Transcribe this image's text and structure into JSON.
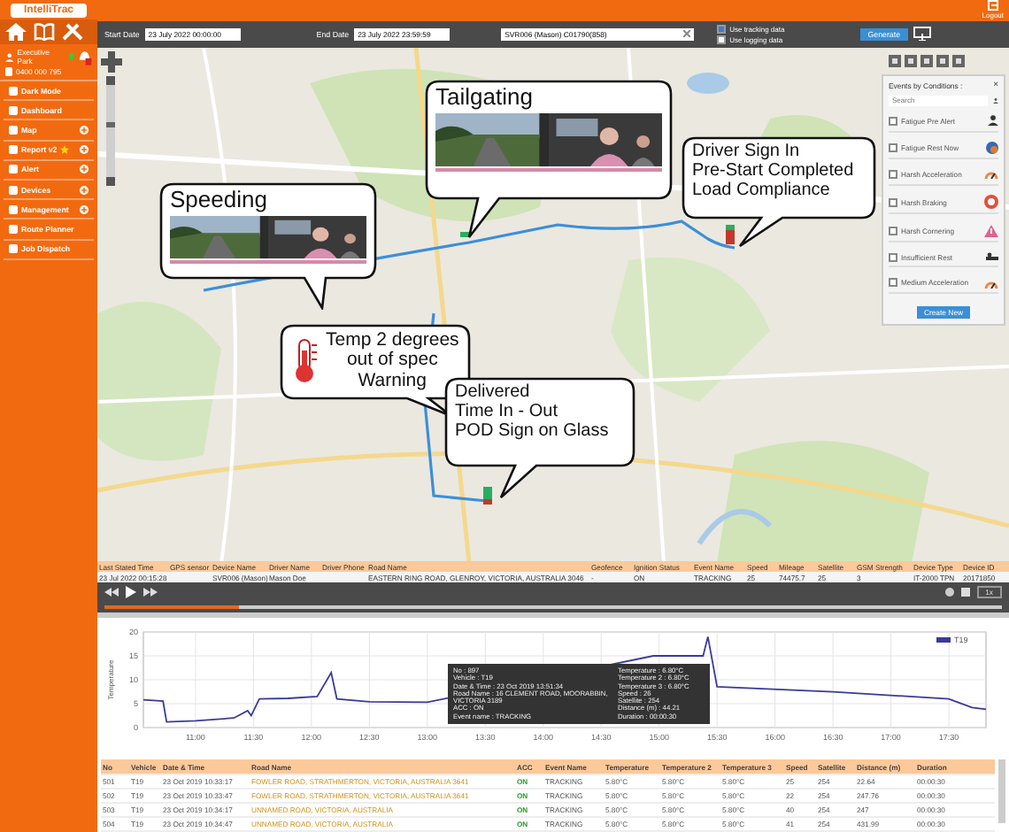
{
  "header": {
    "logout": "Logout"
  },
  "sidebar": {
    "logo": "IntelliTrac",
    "user": {
      "name": "Executive Park",
      "phone": "0400 000 795",
      "alert_badge": true
    },
    "menu": [
      {
        "label": "Dark Mode",
        "expandable": false,
        "starred": false
      },
      {
        "label": "Dashboard",
        "expandable": false,
        "starred": false
      },
      {
        "label": "Map",
        "expandable": true,
        "starred": false
      },
      {
        "label": "Report v2",
        "expandable": true,
        "starred": true
      },
      {
        "label": "Alert",
        "expandable": true,
        "starred": false
      },
      {
        "label": "Devices",
        "expandable": true,
        "starred": false
      },
      {
        "label": "Management",
        "expandable": true,
        "starred": false
      },
      {
        "label": "Route Planner",
        "expandable": false,
        "starred": false
      },
      {
        "label": "Job Dispatch",
        "expandable": false,
        "starred": false
      }
    ]
  },
  "toolbar": {
    "start_date": {
      "label": "Start Date",
      "value": "23 July 2022 00:00:00"
    },
    "end_date": {
      "label": "End Date",
      "value": "23 July 2022 23:59:59"
    },
    "vehicle": {
      "value": "SVR006 (Mason) C01790(858)"
    },
    "options": [
      {
        "label": "Use tracking data",
        "checked": true
      },
      {
        "label": "Use logging data",
        "checked": false
      }
    ],
    "generate": "Generate"
  },
  "map": {
    "callouts": [
      {
        "kind": "video",
        "lines": [
          "Speeding"
        ]
      },
      {
        "kind": "video",
        "lines": [
          "Tailgating"
        ]
      },
      {
        "kind": "text",
        "lines": [
          "Driver Sign In",
          "Pre-Start Completed",
          "Load Compliance"
        ]
      },
      {
        "kind": "temperature",
        "lines": [
          "Temp 2 degrees",
          "out of spec",
          "Warning"
        ]
      },
      {
        "kind": "text",
        "lines": [
          "Delivered",
          "Time In - Out",
          "POD Sign on Glass"
        ]
      }
    ],
    "events_panel": {
      "title": "Events by Conditions :",
      "close": "×",
      "search_placeholder": "Search",
      "items": [
        {
          "label": "Fatigue Pre Alert",
          "checked": false
        },
        {
          "label": "Fatigue Rest Now",
          "checked": false
        },
        {
          "label": "Harsh Acceleration",
          "checked": false
        },
        {
          "label": "Harsh Braking",
          "checked": false
        },
        {
          "label": "Harsh Cornering",
          "checked": false
        },
        {
          "label": "Insufficient Rest",
          "checked": false
        },
        {
          "label": "Medium Acceleration",
          "checked": false
        }
      ],
      "button": "Create New"
    }
  },
  "live_table": {
    "columns": [
      "Last Stated Time",
      "GPS sensor",
      "Device Name",
      "Driver Name",
      "Driver Phone",
      "Road Name",
      "Geofence",
      "Ignition Status",
      "Event Name",
      "Speed",
      "Mileage",
      "Satellite",
      "GSM Strength",
      "Device Type",
      "Device ID"
    ],
    "rows": [
      [
        "23 Jul 2022 00:15:28",
        "",
        "SVR006 (Mason)",
        "Mason Doe",
        "",
        "EASTERN RING ROAD, GLENROY, VICTORIA, AUSTRALIA 3046",
        "-",
        "ON",
        "TRACKING",
        "25",
        "74475.7",
        "25",
        "3",
        "IT-2000 TPN",
        "20171850"
      ]
    ]
  },
  "map_zoom": {
    "level": 0.55
  },
  "player": {
    "level": 0.15,
    "speed": "1x"
  },
  "chart": {
    "tooltip": [
      "No : 897",
      "Vehicle : T19",
      "Date & Time : 23 Oct 2019 13:51:34",
      "Road Name : 16 CLEMENT ROAD, MOORABBIN, VICTORIA 3189",
      "ACC : ON",
      "Event name : TRACKING",
      "Temperature : 6.80°C",
      "Temperature 2 : 6.80°C",
      "Temperature 3 : 6.80°C",
      "Speed : 26",
      "Satellite : 254",
      "Distance (m) : 44.21",
      "Duration : 00:00:30"
    ],
    "chart_data": {
      "type": "line",
      "grid": true,
      "ylabel": "Temperature",
      "x": [
        10.55,
        10.72,
        10.75,
        11.0,
        11.33,
        11.45,
        11.48,
        11.55,
        11.8,
        12.05,
        12.17,
        12.22,
        12.5,
        13.0,
        14.95,
        15.38,
        15.42,
        15.5,
        16.5,
        17.5,
        17.55,
        17.7,
        17.82
      ],
      "series": [
        {
          "name": "T19",
          "color": "#3a3a9a",
          "values": [
            5.8,
            5.5,
            1.2,
            1.4,
            2.0,
            3.5,
            2.5,
            6.0,
            6.1,
            6.5,
            11.5,
            6.0,
            5.4,
            5.3,
            15.0,
            15.0,
            19.0,
            8.5,
            7.5,
            6.0,
            5.5,
            4.2,
            3.8
          ]
        }
      ],
      "xlim": [
        10.55,
        17.82
      ],
      "ylim": [
        0,
        20
      ],
      "yticks": [
        0,
        5,
        10,
        15,
        20
      ],
      "xticks": [
        {
          "value": 11,
          "label": "11:00"
        },
        {
          "value": 11.5,
          "label": "11:30"
        },
        {
          "value": 12,
          "label": "12:00"
        },
        {
          "value": 12.5,
          "label": "12:30"
        },
        {
          "value": 13,
          "label": "13:00"
        },
        {
          "value": 13.5,
          "label": "13:30"
        },
        {
          "value": 14,
          "label": "14:00"
        },
        {
          "value": 14.5,
          "label": "14:30"
        },
        {
          "value": 15,
          "label": "15:00"
        },
        {
          "value": 15.5,
          "label": "15:30"
        },
        {
          "value": 16,
          "label": "16:00"
        },
        {
          "value": 16.5,
          "label": "16:30"
        },
        {
          "value": 17,
          "label": "17:00"
        },
        {
          "value": 17.5,
          "label": "17:30"
        }
      ]
    }
  },
  "history_table": {
    "columns": [
      "No",
      "Vehicle",
      "Date & Time",
      "Road Name",
      "ACC",
      "Event Name",
      "Temperature",
      "Temperature 2",
      "Temperature 3",
      "Speed",
      "Satellite",
      "Distance (m)",
      "Duration"
    ],
    "rows": [
      [
        "501",
        "T19",
        "23 Oct 2019 10:33:17",
        "FOWLER ROAD, STRATHMERTON, VICTORIA, AUSTRALIA 3641",
        "ON",
        "TRACKING",
        "5.80°C",
        "5.80°C",
        "5.80°C",
        "25",
        "254",
        "22.64",
        "00:00:30"
      ],
      [
        "502",
        "T19",
        "23 Oct 2019 10:33:47",
        "FOWLER ROAD, STRATHMERTON, VICTORIA, AUSTRALIA 3641",
        "ON",
        "TRACKING",
        "5.80°C",
        "5.80°C",
        "5.80°C",
        "22",
        "254",
        "247.76",
        "00:00:30"
      ],
      [
        "503",
        "T19",
        "23 Oct 2019 10:34:17",
        "UNNAMED ROAD, VICTORIA, AUSTRALIA",
        "ON",
        "TRACKING",
        "5.80°C",
        "5.80°C",
        "5.80°C",
        "40",
        "254",
        "247",
        "00:00:30"
      ],
      [
        "504",
        "T19",
        "23 Oct 2019 10:34:47",
        "UNNAMED ROAD, VICTORIA, AUSTRALIA",
        "ON",
        "TRACKING",
        "5.80°C",
        "5.80°C",
        "5.80°C",
        "41",
        "254",
        "431.99",
        "00:00:30"
      ]
    ]
  }
}
